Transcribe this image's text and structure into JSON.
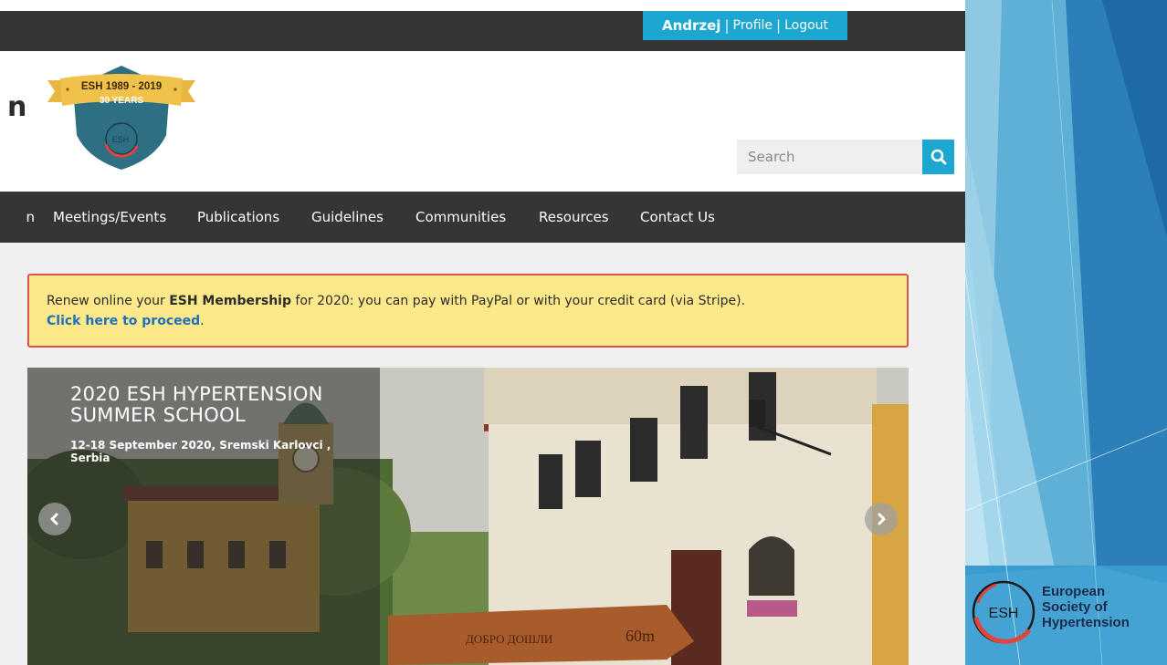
{
  "topbar": {
    "user_name": "Andrzej",
    "separator": "|",
    "profile_label": "Profile",
    "logout_label": "Logout",
    "accent_color": "#1ba7cf"
  },
  "header": {
    "site_title_fragment": "n",
    "badge": {
      "years_label": "ESH 1989 - 2019",
      "anniversary_label": "30 YEARS",
      "emblem_text": "ESH"
    },
    "search": {
      "placeholder": "Search",
      "icon": "search-icon"
    }
  },
  "nav": {
    "items": [
      {
        "label": "n"
      },
      {
        "label": "Meetings/Events"
      },
      {
        "label": "Publications"
      },
      {
        "label": "Guidelines"
      },
      {
        "label": "Communities"
      },
      {
        "label": "Resources"
      },
      {
        "label": "Contact Us"
      }
    ]
  },
  "notice": {
    "text_before": "Renew online your ",
    "bold_text": "ESH Membership",
    "text_after": " for 2020: you can pay with PayPal or with your credit card (via Stripe).",
    "link_text": "Click here to proceed",
    "link_suffix": ".",
    "background_color": "#fde88a",
    "border_color": "#d9534f"
  },
  "slider": {
    "title": "2020 ESH HYPERTENSION SUMMER SCHOOL",
    "subtitle": "12-18 September 2020, Sremski Karlovci , Serbia",
    "prev_icon": "chevron-left-icon",
    "next_icon": "chevron-right-icon",
    "sign_text_1": "ДОБРО ДОШЛИ",
    "sign_text_2": "60m"
  },
  "sidebar": {
    "logo_emblem": "ESH",
    "logo_line1": "European",
    "logo_line2": "Society of",
    "logo_line3": "Hypertension"
  }
}
